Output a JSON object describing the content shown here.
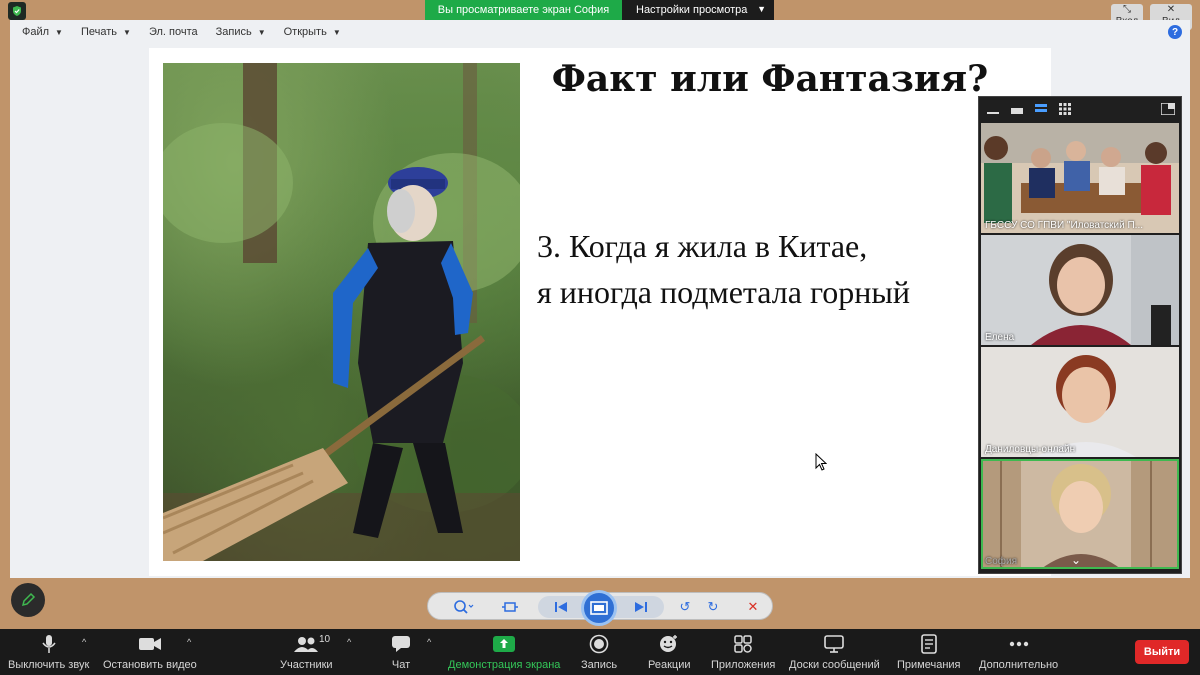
{
  "topbar": {
    "viewing_text": "Вы просматриваете экран София",
    "view_options_label": "Настройки просмотра",
    "exit_label": "Вход",
    "view_label": "Вид"
  },
  "menubar": {
    "items": [
      "Файл",
      "Печать",
      "Эл. почта",
      "Запись",
      "Открыть"
    ]
  },
  "slide": {
    "title": "Факт или Фантазия?",
    "line1": "3. Когда я жила в Китае,",
    "line2": "я иногда подметала горный"
  },
  "gallery": {
    "participants": [
      {
        "name": "ГБССУ СО ГПВИ \"Иловатский П..."
      },
      {
        "name": "Елена"
      },
      {
        "name": "Даниловцы-онлайн"
      },
      {
        "name": "София"
      }
    ]
  },
  "bottombar": {
    "mute": "Выключить звук",
    "stop_video": "Остановить видео",
    "participants": "Участники",
    "participants_count": "10",
    "chat": "Чат",
    "share": "Демонстрация экрана",
    "record": "Запись",
    "reactions": "Реакции",
    "apps": "Приложения",
    "whiteboards": "Доски сообщений",
    "notes": "Примечания",
    "more": "Дополнительно",
    "leave": "Выйти"
  },
  "colors": {
    "share_green": "#1eaa48",
    "leave_red": "#e02828",
    "accent_blue": "#2d6cdf"
  }
}
